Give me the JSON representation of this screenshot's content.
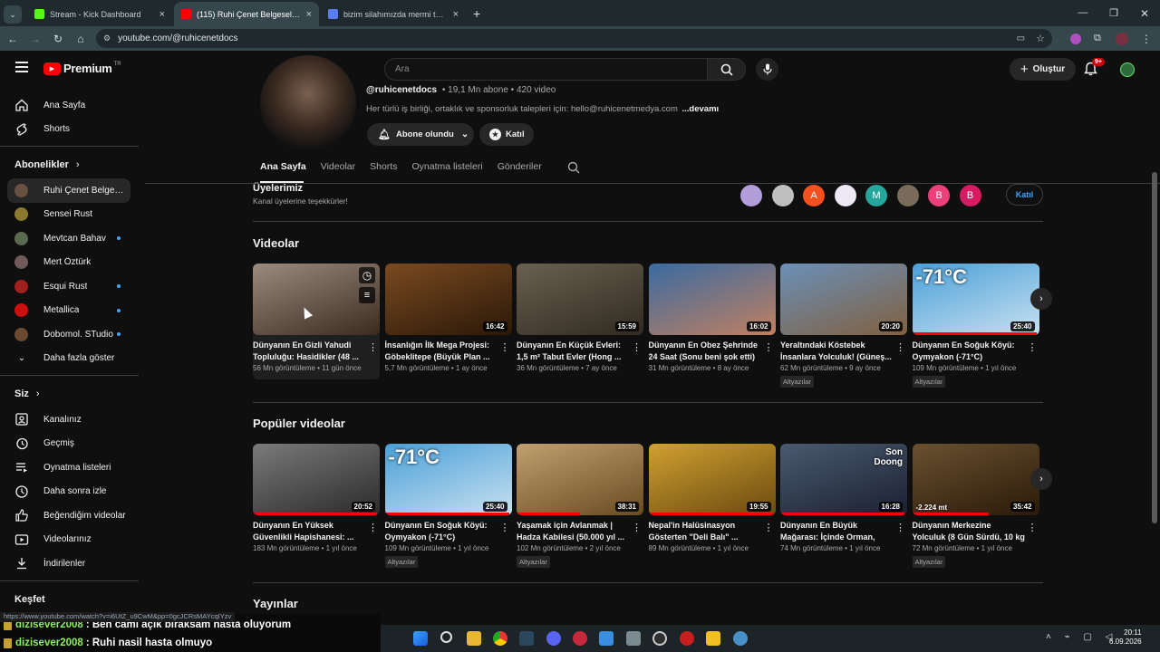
{
  "browser": {
    "tabs": [
      {
        "title": "Stream - Kick Dashboard",
        "active": false,
        "icon": "kick-icon",
        "color": "#53fc18"
      },
      {
        "title": "(115) Ruhi Çenet Belgeselleri - YouTube",
        "active": true,
        "icon": "youtube-icon",
        "color": "#ff0000"
      },
      {
        "title": "bizim silahımızda mermi ters dönüyor",
        "active": false,
        "icon": "r-icon",
        "color": "#5b7cf7"
      }
    ],
    "url": "youtube.com/@ruhicenetdocs"
  },
  "youtube": {
    "logo": "Premium",
    "logo_region": "TR",
    "search_placeholder": "Ara",
    "create_label": "Oluştur",
    "notif_count": "9+"
  },
  "sidebar": {
    "main": [
      {
        "label": "Ana Sayfa",
        "icon": "home-icon"
      },
      {
        "label": "Shorts",
        "icon": "shorts-icon"
      }
    ],
    "subs_header": "Abonelikler",
    "subs": [
      {
        "label": "Ruhi Çenet Belgese...",
        "color": "#6a5040",
        "selected": true,
        "dot": false
      },
      {
        "label": "Sensei Rust",
        "color": "#8a7a30",
        "selected": false,
        "dot": false
      },
      {
        "label": "Mevtcan Bahav",
        "color": "#5a6a50",
        "selected": false,
        "dot": true
      },
      {
        "label": "Mert Öztürk",
        "color": "#705a5a",
        "selected": false,
        "dot": false
      },
      {
        "label": "Esqui Rust",
        "color": "#a02020",
        "selected": false,
        "dot": true
      },
      {
        "label": "Metallica",
        "color": "#cc1010",
        "selected": false,
        "dot": true
      },
      {
        "label": "Dobomol. STudio",
        "color": "#6a4a30",
        "selected": false,
        "dot": true
      }
    ],
    "more_label": "Daha fazla göster",
    "you_header": "Siz",
    "you": [
      {
        "label": "Kanalınız",
        "icon": "channel-icon"
      },
      {
        "label": "Geçmiş",
        "icon": "history-icon"
      },
      {
        "label": "Oynatma listeleri",
        "icon": "playlists-icon"
      },
      {
        "label": "Daha sonra izle",
        "icon": "watch-later-icon"
      },
      {
        "label": "Beğendiğim videolar",
        "icon": "like-icon"
      },
      {
        "label": "Videolarınız",
        "icon": "your-videos-icon"
      },
      {
        "label": "İndirilenler",
        "icon": "download-icon"
      }
    ],
    "explore_header": "Keşfet"
  },
  "channel": {
    "handle": "@ruhicenetdocs",
    "stats": "• 19,1 Mn abone • 420 video",
    "description": "Her türlü iş birliği, ortaklık ve sponsorluk talepleri için: hello@ruhicenetmedya.com",
    "more": "...devamı",
    "subscribed_label": "Abone olundu",
    "join_label": "Katıl",
    "tabs": [
      "Ana Sayfa",
      "Videolar",
      "Shorts",
      "Oynatma listeleri",
      "Gönderiler"
    ],
    "members_title": "Üyelerimiz",
    "members_sub": "Kanal üyelerine teşekkürler!",
    "members": [
      {
        "letter": "",
        "color": "#b39ddb"
      },
      {
        "letter": "",
        "color": "#c0c0c0"
      },
      {
        "letter": "A",
        "color": "#f4511e"
      },
      {
        "letter": "",
        "color": "#ede7f6"
      },
      {
        "letter": "M",
        "color": "#26a69a"
      },
      {
        "letter": "",
        "color": "#7a6a5a"
      },
      {
        "letter": "B",
        "color": "#ec407a"
      },
      {
        "letter": "B",
        "color": "#d81b60"
      }
    ],
    "members_join": "Katıl"
  },
  "sections": {
    "videos_title": "Videolar",
    "popular_title": "Popüler videolar",
    "posts_title": "Yayınlar"
  },
  "videos": [
    {
      "title": "Dünyanın En Gizli Yahudi Topluluğu: Hasidikler (48 ...",
      "meta": "56 Mn görüntüleme • 11 gün önce",
      "dur": "",
      "badge": "",
      "c1": "#9a8a80",
      "c2": "#3a2a20",
      "progress": 0,
      "hover": true
    },
    {
      "title": "İnsanlığın İlk Mega Projesi: Göbeklitepe (Büyük Plan ...",
      "meta": "5,7 Mn görüntüleme • 1 ay önce",
      "dur": "16:42",
      "badge": "",
      "c1": "#7a4a20",
      "c2": "#2a1808",
      "progress": 0,
      "hover": false
    },
    {
      "title": "Dünyanın En Küçük Evleri: 1,5 m² Tabut Evler (Hong ...",
      "meta": "36 Mn görüntüleme • 7 ay önce",
      "dur": "15:59",
      "badge": "",
      "c1": "#6a6050",
      "c2": "#302a20",
      "progress": 0,
      "hover": false
    },
    {
      "title": "Dünyanın En Obez Şehrinde 24 Saat (Sonu beni şok etti)",
      "meta": "31 Mn görüntüleme • 8 ay önce",
      "dur": "16:02",
      "badge": "",
      "c1": "#3a6aa0",
      "c2": "#c08060",
      "progress": 0,
      "hover": false
    },
    {
      "title": "Yeraltındaki Köstebek İnsanlara Yolculuk! (Güneş...",
      "meta": "62 Mn görüntüleme • 9 ay önce",
      "dur": "20:20",
      "badge": "Altyazılar",
      "c1": "#6a90b8",
      "c2": "#806040",
      "progress": 0,
      "hover": false
    },
    {
      "title": "Dünyanın En Soğuk Köyü: Oymyakon (-71°C)",
      "meta": "109 Mn görüntüleme • 1 yıl önce",
      "dur": "25:40",
      "badge": "Altyazılar",
      "c1": "#4aa0d8",
      "c2": "#c8e0f0",
      "progress": 0.98,
      "hover": false,
      "overlay": "-71°C"
    }
  ],
  "popular": [
    {
      "title": "Dünyanın En Yüksek Güvenlikli Hapishanesi: ...",
      "meta": "183 Mn görüntüleme • 1 yıl önce",
      "dur": "20:52",
      "badge": "",
      "c1": "#7a7a7a",
      "c2": "#2a2a2a",
      "progress": 0.98
    },
    {
      "title": "Dünyanın En Soğuk Köyü: Oymyakon (-71°C)",
      "meta": "109 Mn görüntüleme • 1 yıl önce",
      "dur": "25:40",
      "badge": "Altyazılar",
      "c1": "#4aa0d8",
      "c2": "#c8e0f0",
      "progress": 0.98,
      "overlay": "-71°C"
    },
    {
      "title": "Yaşamak için Avlanmak | Hadza Kabilesi (50.000 yıl ...",
      "meta": "102 Mn görüntüleme • 2 yıl önce",
      "dur": "38:31",
      "badge": "Altyazılar",
      "c1": "#c0a070",
      "c2": "#6a4a20",
      "progress": 0.5
    },
    {
      "title": "Nepal'in Halüsinasyon Gösterten \"Deli Balı\" ...",
      "meta": "89 Mn görüntüleme • 1 yıl önce",
      "dur": "19:55",
      "badge": "",
      "c1": "#d0a030",
      "c2": "#6a4a10",
      "progress": 0.98
    },
    {
      "title": "Dünyanın En Büyük Mağarası: İçinde Orman, Nehir ve ...",
      "meta": "74 Mn görüntüleme • 1 yıl önce",
      "dur": "16:28",
      "badge": "",
      "c1": "#4a5a70",
      "c2": "#1a2030",
      "progress": 0.98,
      "overlay": "Son Doong"
    },
    {
      "title": "Dünyanın Merkezine Yolculuk (8 Gün Sürdü, 10 kg ...",
      "meta": "72 Mn görüntüleme • 1 yıl önce",
      "dur": "35:42",
      "badge": "Altyazılar",
      "c1": "#6a5030",
      "c2": "#2a1a08",
      "progress": 0.6,
      "overlay": "-2.224 mt"
    }
  ],
  "status_url": "https://www.youtube.com/watch?v=i6UtZ_u9CwM&pp=0gcJCRsMAYcqIYzv",
  "chat": [
    {
      "user": "dizisever2008",
      "text": ": Ben cami açık bıraksam hasta oluyorum"
    },
    {
      "user": "dizisever2008",
      "text": ": Ruhi nasil hasta olmuyo"
    }
  ],
  "taskbar": {
    "time": "20:11",
    "date": "6.09.2026"
  }
}
